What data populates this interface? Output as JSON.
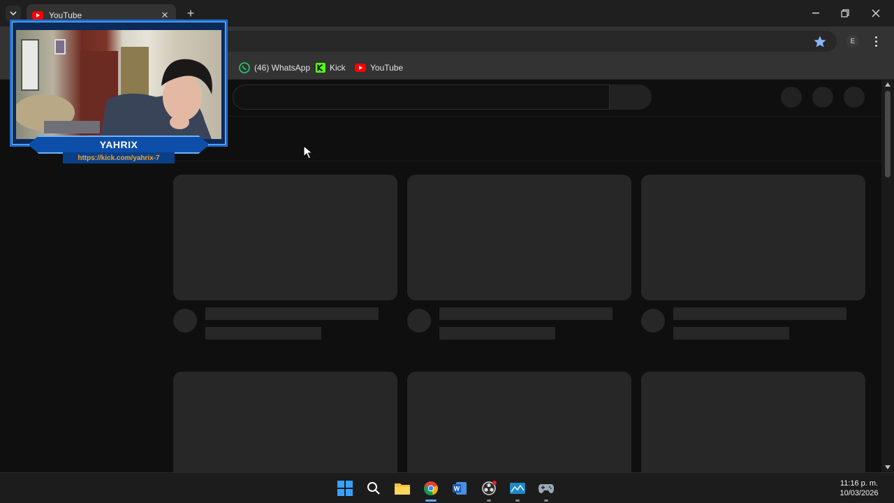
{
  "browser": {
    "tab_title": "YouTube",
    "bookmarks": [
      {
        "label": "(46) WhatsApp",
        "icon": "whatsapp-icon"
      },
      {
        "label": "Kick",
        "icon": "kick-icon"
      },
      {
        "label": "YouTube",
        "icon": "youtube-icon"
      }
    ],
    "profile_initial": "E"
  },
  "webcam": {
    "name": "YAHRIX",
    "url": "https://kick.com/yahrix-7"
  },
  "taskbar": {
    "apps": [
      "windows-start-icon",
      "search-icon",
      "file-explorer-icon",
      "chrome-icon",
      "word-icon",
      "obs-icon",
      "monitor-app-icon",
      "controller-icon"
    ],
    "time": "11:16 p. m.",
    "date": "10/03/2026"
  },
  "colors": {
    "youtube_red": "#ff0000",
    "whatsapp_green": "#25d366",
    "kick_green": "#53fc18",
    "cam_blue": "#1f6fd0",
    "cam_url_orange": "#f2a531"
  }
}
